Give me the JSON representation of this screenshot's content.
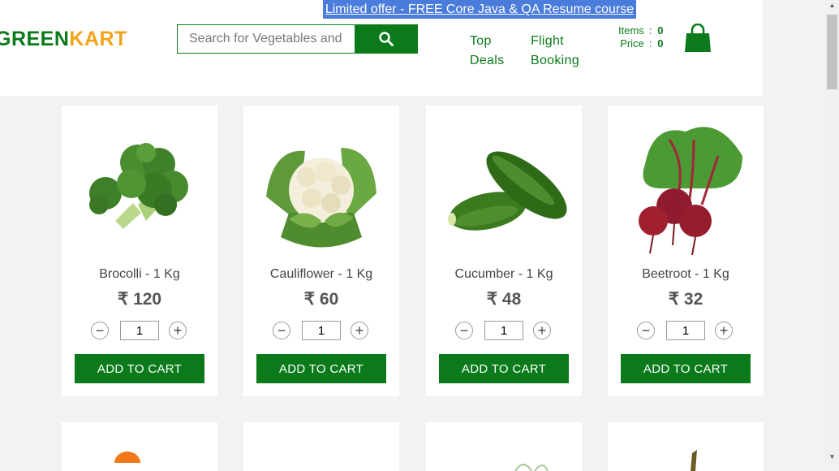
{
  "promo": {
    "text": "Limited offer - FREE Core Java & QA Resume course"
  },
  "logo": {
    "part1": "GREEN",
    "part2": "KART"
  },
  "search": {
    "placeholder": "Search for Vegetables and Fruits"
  },
  "nav": {
    "top_deals": [
      "Top",
      "Deals"
    ],
    "flight_booking": [
      "Flight",
      "Booking"
    ]
  },
  "cart": {
    "items_label": "Items",
    "items_value": "0",
    "price_label": "Price",
    "price_value": "0"
  },
  "colors": {
    "brand_green": "#0b7a1b",
    "brand_orange": "#f2a319",
    "promo_blue": "#4a7cdb"
  },
  "products": [
    {
      "name": "Brocolli - 1 Kg",
      "price": "₹ 120",
      "qty": "1",
      "button": "ADD TO CART",
      "icon": "broccoli-image"
    },
    {
      "name": "Cauliflower - 1 Kg",
      "price": "₹ 60",
      "qty": "1",
      "button": "ADD TO CART",
      "icon": "cauliflower-image"
    },
    {
      "name": "Cucumber - 1 Kg",
      "price": "₹ 48",
      "qty": "1",
      "button": "ADD TO CART",
      "icon": "cucumber-image"
    },
    {
      "name": "Beetroot - 1 Kg",
      "price": "₹ 32",
      "qty": "1",
      "button": "ADD TO CART",
      "icon": "beetroot-image"
    }
  ]
}
